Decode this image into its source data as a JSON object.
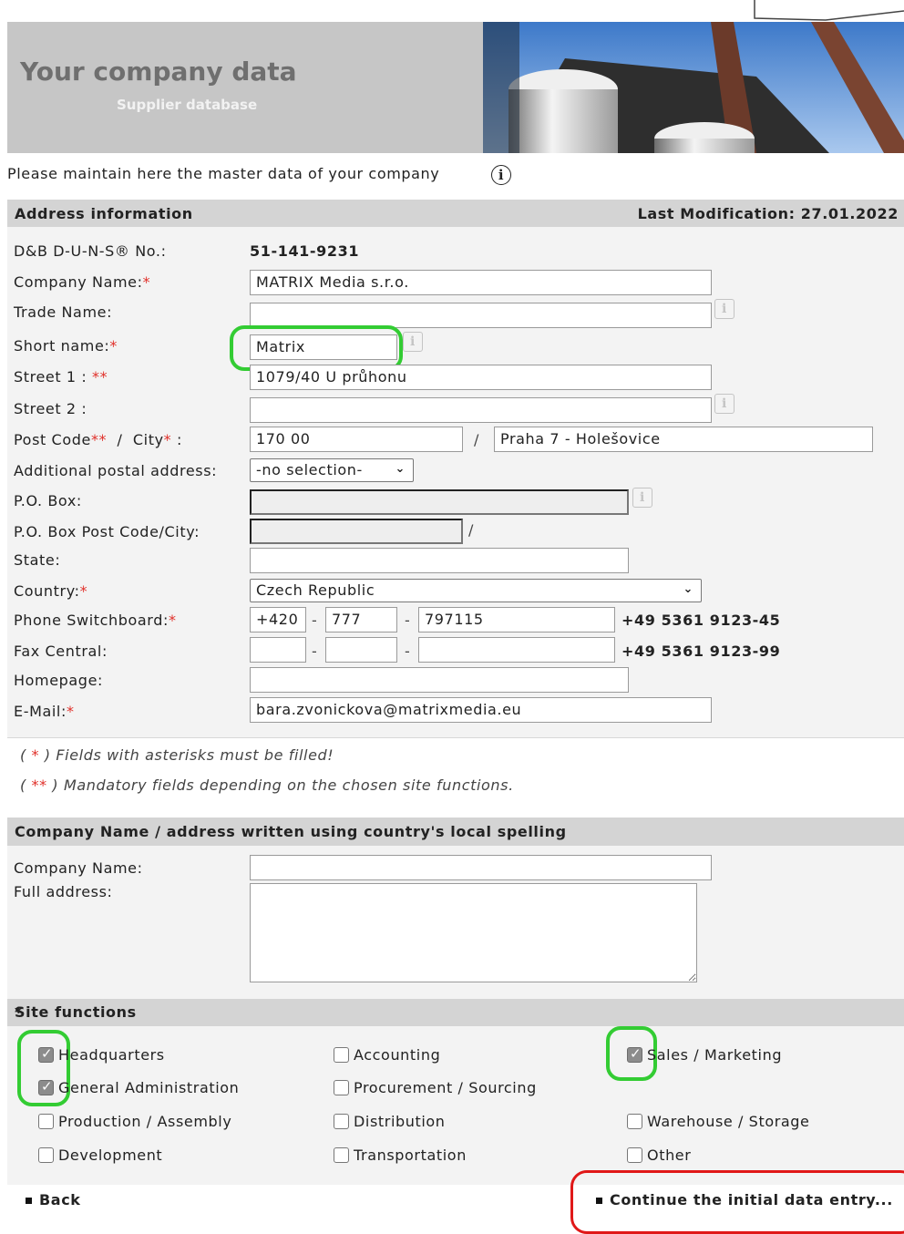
{
  "banner": {
    "title": "Your company data",
    "subtitle": "Supplier database"
  },
  "intro": {
    "text": "Please maintain here the master data of your company",
    "info_icon": "info-circle-icon"
  },
  "address": {
    "header": "Address information",
    "last_modification": "Last Modification: 27.01.2022",
    "duns_label": "D&B D-U-N-S® No.:",
    "duns_value": "51-141-9231",
    "company_name_label": "Company Name:",
    "company_name_value": "MATRIX Media s.r.o.",
    "trade_name_label": "Trade Name:",
    "trade_name_value": "",
    "short_name_label": "Short name:",
    "short_name_value": "Matrix",
    "street1_label": "Street 1 :",
    "street1_value": "1079/40 U průhonu",
    "street2_label": "Street 2 :",
    "street2_value": "",
    "postcode_label": "Post Code",
    "city_label": "City",
    "postcode_value": "170 00",
    "city_value": "Praha 7 - Holešovice",
    "additional_postal_label": "Additional postal address:",
    "additional_postal_value": "-no selection-",
    "po_box_label": "P.O. Box:",
    "po_box_city_label": "P.O. Box Post Code/City:",
    "state_label": "State:",
    "country_label": "Country:",
    "country_value": "Czech Republic",
    "phone_label": "Phone Switchboard:",
    "phone_country": "+420",
    "phone_area": "777",
    "phone_number": "797115",
    "phone_hint": "+49 5361 9123-45",
    "fax_label": "Fax Central:",
    "fax_hint": "+49 5361 9123-99",
    "homepage_label": "Homepage:",
    "email_label": "E-Mail:",
    "email_value": "bara.zvonickova@matrixmedia.eu",
    "separator_slash": "/",
    "separator_dash": "-"
  },
  "notes": {
    "single_star_open": "( ",
    "single_star": "*",
    "single_star_text": " ) Fields with asterisks must be filled!",
    "double_star_open": "( ",
    "double_star": "**",
    "double_star_text": " ) Mandatory fields depending on the chosen site functions."
  },
  "local_spelling": {
    "header": "Company Name / address written using country's local spelling",
    "company_name_label": "Company Name:",
    "full_address_label": "Full address:"
  },
  "site_functions": {
    "header": "Site functions",
    "items": [
      {
        "label": "Headquarters",
        "checked": true
      },
      {
        "label": "Accounting",
        "checked": false
      },
      {
        "label": "Sales / Marketing",
        "checked": true
      },
      {
        "label": "General Administration",
        "checked": true
      },
      {
        "label": "Procurement / Sourcing",
        "checked": false
      },
      {
        "label": "Production / Assembly",
        "checked": false
      },
      {
        "label": "Distribution",
        "checked": false
      },
      {
        "label": "Warehouse / Storage",
        "checked": false
      },
      {
        "label": "Development",
        "checked": false
      },
      {
        "label": "Transportation",
        "checked": false
      },
      {
        "label": "Other",
        "checked": false
      }
    ]
  },
  "nav": {
    "back": "Back",
    "continue": "Continue the initial data entry..."
  },
  "colors": {
    "highlight_green": "#33cc33",
    "highlight_red": "#e01818",
    "required_star": "#e0302a",
    "section_bg": "#d4d4d4"
  }
}
